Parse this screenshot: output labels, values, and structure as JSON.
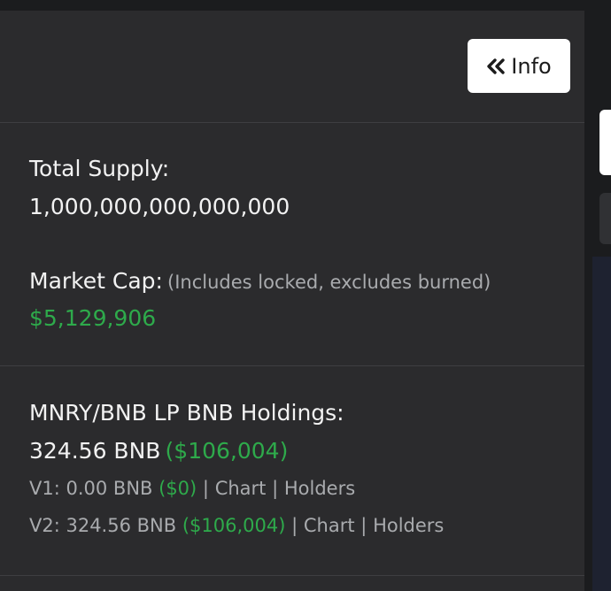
{
  "header": {
    "info_button_label": "Info",
    "info_button_icon": "double-chevron-left-icon"
  },
  "supply": {
    "label": "Total Supply:",
    "value": "1,000,000,000,000,000"
  },
  "market_cap": {
    "label": "Market Cap:",
    "note": "(Includes locked, excludes burned)",
    "value": "$5,129,906"
  },
  "lp": {
    "label": "MNRY/BNB LP BNB Holdings:",
    "amount": "324.56 BNB",
    "usd": "($106,004)",
    "v1": {
      "prefix": "V1: 0.00 BNB",
      "usd": "($0)",
      "chart": "Chart",
      "holders": "Holders"
    },
    "v2": {
      "prefix": "V2: 324.56 BNB",
      "usd": "($106,004)",
      "chart": "Chart",
      "holders": "Holders"
    },
    "separator": "|"
  },
  "colors": {
    "panel": "#2b2b2d",
    "page": "#1b1c1e",
    "green": "#2eaa4b",
    "text": "#f2f2f2",
    "muted": "#a9abae"
  }
}
